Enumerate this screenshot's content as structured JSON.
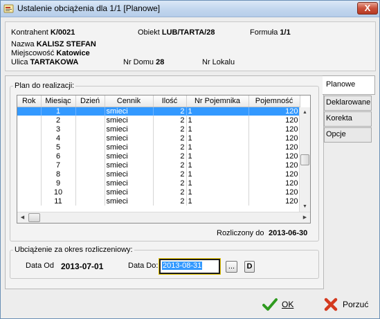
{
  "window": {
    "title": "Ustalenie obciążenia dla 1/1   [Planowe]",
    "close_label": "X"
  },
  "info": {
    "kontrahent_label": "Kontrahent",
    "kontrahent_value": "K/0021",
    "obiekt_label": "Obiekt",
    "obiekt_value": "LUB/TARTA/28",
    "formula_label": "Formuła",
    "formula_value": "1/1",
    "nazwa_label": "Nazwa",
    "nazwa_value": "KALISZ STEFAN",
    "miejscowosc_label": "Miejscowość",
    "miejscowosc_value": "Katowice",
    "ulica_label": "Ulica",
    "ulica_value": "TARTAKOWA",
    "nr_domu_label": "Nr Domu",
    "nr_domu_value": "28",
    "nr_lokalu_label": "Nr Lokalu",
    "nr_lokalu_value": ""
  },
  "tabs": [
    "Planowe",
    "Deklarowane",
    "Korekta",
    "Opcje"
  ],
  "plan": {
    "group_label": "Plan do realizacji:",
    "columns": [
      "Rok",
      "Miesiąc",
      "Dzień",
      "Cennik",
      "Ilość",
      "Nr Pojemnika",
      "Pojemność"
    ],
    "rows": [
      [
        "",
        "1",
        "",
        "smieci",
        "2",
        "1",
        "120"
      ],
      [
        "",
        "2",
        "",
        "smieci",
        "2",
        "1",
        "120"
      ],
      [
        "",
        "3",
        "",
        "smieci",
        "2",
        "1",
        "120"
      ],
      [
        "",
        "4",
        "",
        "smieci",
        "2",
        "1",
        "120"
      ],
      [
        "",
        "5",
        "",
        "smieci",
        "2",
        "1",
        "120"
      ],
      [
        "",
        "6",
        "",
        "smieci",
        "2",
        "1",
        "120"
      ],
      [
        "",
        "7",
        "",
        "smieci",
        "2",
        "1",
        "120"
      ],
      [
        "",
        "8",
        "",
        "smieci",
        "2",
        "1",
        "120"
      ],
      [
        "",
        "9",
        "",
        "smieci",
        "2",
        "1",
        "120"
      ],
      [
        "",
        "10",
        "",
        "smieci",
        "2",
        "1",
        "120"
      ],
      [
        "",
        "11",
        "",
        "smieci",
        "2",
        "1",
        "120"
      ]
    ],
    "selected_row": 0,
    "rozliczony_label": "Rozliczony do",
    "rozliczony_value": "2013-06-30"
  },
  "period": {
    "group_label": "Ubciążenie za okres rozliczeniowy:",
    "data_od_label": "Data Od",
    "data_od_value": "2013-07-01",
    "data_do_label": "Data Do:",
    "data_do_value": "2013-08-31",
    "browse_label": "...",
    "d_label": "D"
  },
  "buttons": {
    "ok_label": "OK",
    "cancel_label": "Porzuć"
  },
  "colors": {
    "selection": "#3399ff",
    "title_gradient_top": "#dbe8f7",
    "close": "#c9503a",
    "ok_icon": "#2e9a1f",
    "cancel_icon": "#d43a1f"
  }
}
